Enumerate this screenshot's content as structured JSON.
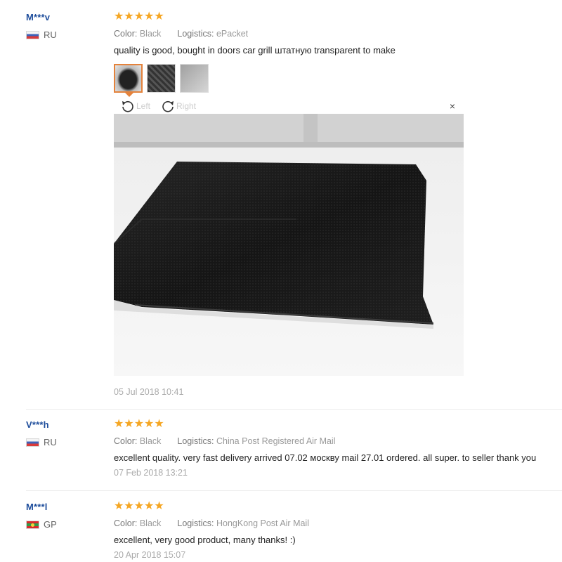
{
  "labels": {
    "color": "Color:",
    "logistics": "Logistics:"
  },
  "viewer": {
    "rotate_left": "Left",
    "rotate_right": "Right",
    "close": "×"
  },
  "reviews": [
    {
      "buyer": "M***v",
      "country": "RU",
      "stars": "★★★★★",
      "rating": 5,
      "color": "Black",
      "logistics": "ePacket",
      "text": "quality is good, bought in doors car grill штатную transparent to make",
      "date": "05 Jul 2018 10:41",
      "photo_count": 3
    },
    {
      "buyer": "V***h",
      "country": "RU",
      "stars": "★★★★★",
      "rating": 5,
      "color": "Black",
      "logistics": "China Post Registered Air Mail",
      "text": "excellent quality. very fast delivery arrived 07.02 москву mail 27.01 ordered. all super. to seller thank you",
      "date": "07 Feb 2018 13:21"
    },
    {
      "buyer": "M***l",
      "country": "GP",
      "stars": "★★★★★",
      "rating": 5,
      "color": "Black",
      "logistics": "HongKong Post Air Mail",
      "text": "excellent, very good product, many thanks! :)",
      "date": "20 Apr 2018 15:07"
    }
  ],
  "colors": {
    "buyer_name": "#1f4e9c",
    "stars": "#f5a623",
    "active_thumb": "#e4823b"
  }
}
